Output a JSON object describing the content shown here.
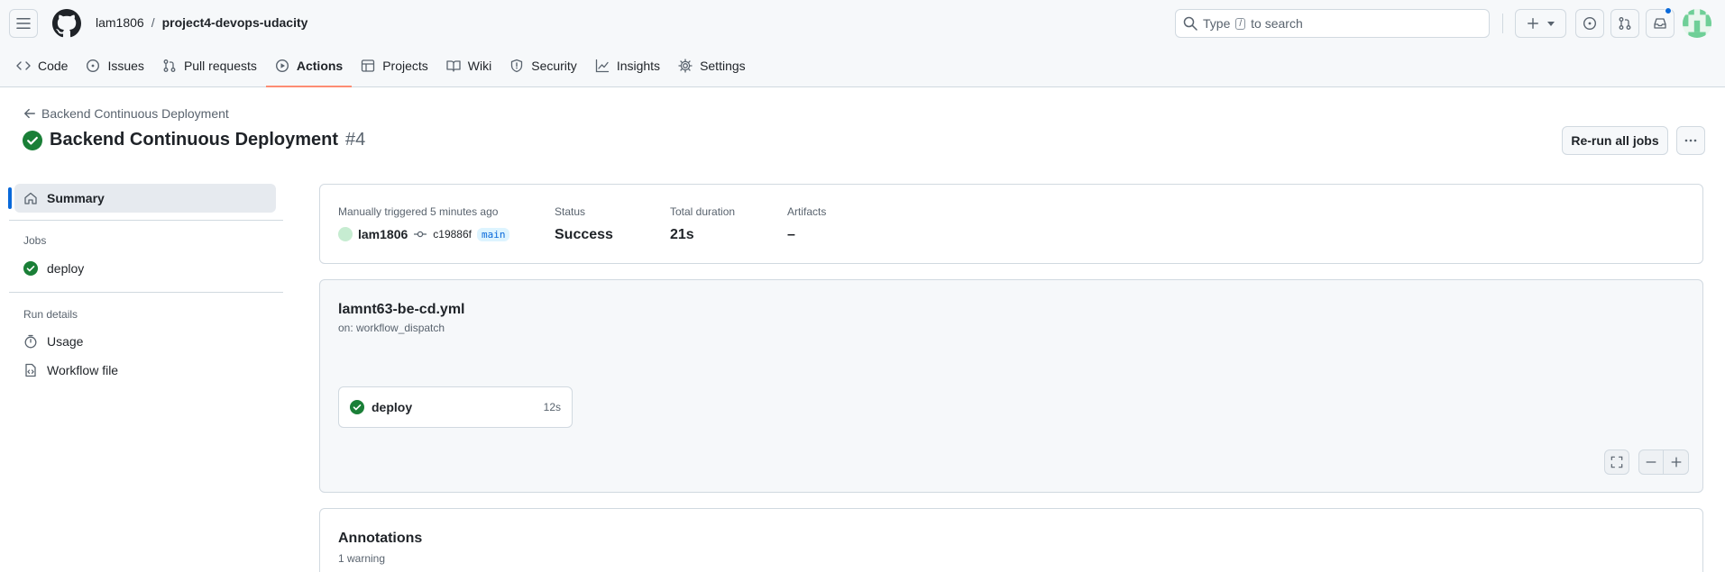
{
  "header": {
    "owner": "lam1806",
    "separator": "/",
    "repo": "project4-devops-udacity",
    "search_prefix": "Type",
    "search_key": "/",
    "search_suffix": "to search"
  },
  "nav": {
    "tabs": [
      {
        "label": "Code",
        "icon": "code-icon"
      },
      {
        "label": "Issues",
        "icon": "issue-opened-icon"
      },
      {
        "label": "Pull requests",
        "icon": "git-pull-request-icon"
      },
      {
        "label": "Actions",
        "icon": "play-icon",
        "active": true
      },
      {
        "label": "Projects",
        "icon": "table-icon"
      },
      {
        "label": "Wiki",
        "icon": "book-icon"
      },
      {
        "label": "Security",
        "icon": "shield-icon"
      },
      {
        "label": "Insights",
        "icon": "graph-icon"
      },
      {
        "label": "Settings",
        "icon": "gear-icon"
      }
    ]
  },
  "page": {
    "back_label": "Backend Continuous Deployment",
    "title": "Backend Continuous Deployment",
    "run_number": "#4",
    "rerun_label": "Re-run all jobs"
  },
  "sidebar": {
    "summary_label": "Summary",
    "jobs_heading": "Jobs",
    "jobs": [
      {
        "label": "deploy",
        "status": "success"
      }
    ],
    "run_details_heading": "Run details",
    "details": [
      {
        "label": "Usage",
        "icon": "stopwatch-icon"
      },
      {
        "label": "Workflow file",
        "icon": "file-code-icon"
      }
    ]
  },
  "summary": {
    "trigger_label": "Manually triggered 5 minutes ago",
    "actor": "lam1806",
    "commit": "c19886f",
    "branch": "main",
    "status_label": "Status",
    "status_value": "Success",
    "duration_label": "Total duration",
    "duration_value": "21s",
    "artifacts_label": "Artifacts",
    "artifacts_value": "–"
  },
  "workflow": {
    "file": "lamnt63-be-cd.yml",
    "trigger": "on: workflow_dispatch",
    "job_name": "deploy",
    "job_duration": "12s"
  },
  "annotations": {
    "title": "Annotations",
    "subtitle": "1 warning"
  },
  "colors": {
    "success": "#1a7f37",
    "accent": "#0969da",
    "active_tab": "#fd8c73"
  }
}
